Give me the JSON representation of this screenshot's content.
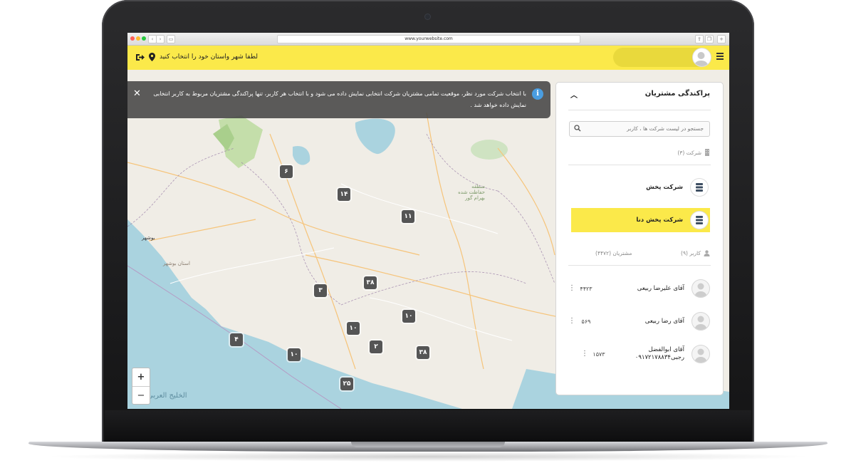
{
  "browser": {
    "url": "www.yourwebsite.com"
  },
  "header": {
    "title": "لطفا شهر واستان خود را انتخاب کنید",
    "menu_icon": "hamburger-icon",
    "accent": "#fbe94a"
  },
  "banner": {
    "text": "با انتخاب شرکت مورد نظر، موقعیت تمامی مشتریان شرکت انتخابی نمایش داده می شود و با انتخاب هر کاربر، تنها پراکندگی مشتریان مربوط به کاربر انتخابی نمایش داده خواهد شد .",
    "info_symbol": "i",
    "close_symbol": "✕"
  },
  "map": {
    "clusters": [
      "۶",
      "۱۴",
      "۱۱",
      "۳۸",
      "۳",
      "۱۰",
      "۴",
      "۱۰",
      "۲",
      "۳۸",
      "۱۰",
      "۲۵"
    ],
    "zoom_in": "+",
    "zoom_out": "−",
    "labels": {
      "gulf": "الخلیج العربی",
      "bushehr": "بوشهر",
      "bushehr_province": "استان بوشهر",
      "protected": "منطقه حفاظت شده بهرام گور"
    }
  },
  "panel": {
    "title": "پراکندگی مشتریان",
    "search_placeholder": "جستجو در لیست شرکت ها ، کاربر",
    "companies_header": "شرکت (۳)",
    "companies": [
      {
        "name": "شرکت پخش",
        "active": false
      },
      {
        "name": "شرکت پخش دنا",
        "active": true
      }
    ],
    "users_header": "کاربر (۹)",
    "customers_header": "مشتریان (۴۴۷۲)",
    "users": [
      {
        "name": "آقای علیرضا ربیعی",
        "count": "۴۴۲۳"
      },
      {
        "name": "آقای رضا ربیعی",
        "count": "۵۶۹"
      },
      {
        "name": "آقای ابوالفضل رجبی۰۹۱۷۲۱۷۸۸۳۴",
        "count": "۱۵۷۳"
      }
    ]
  }
}
